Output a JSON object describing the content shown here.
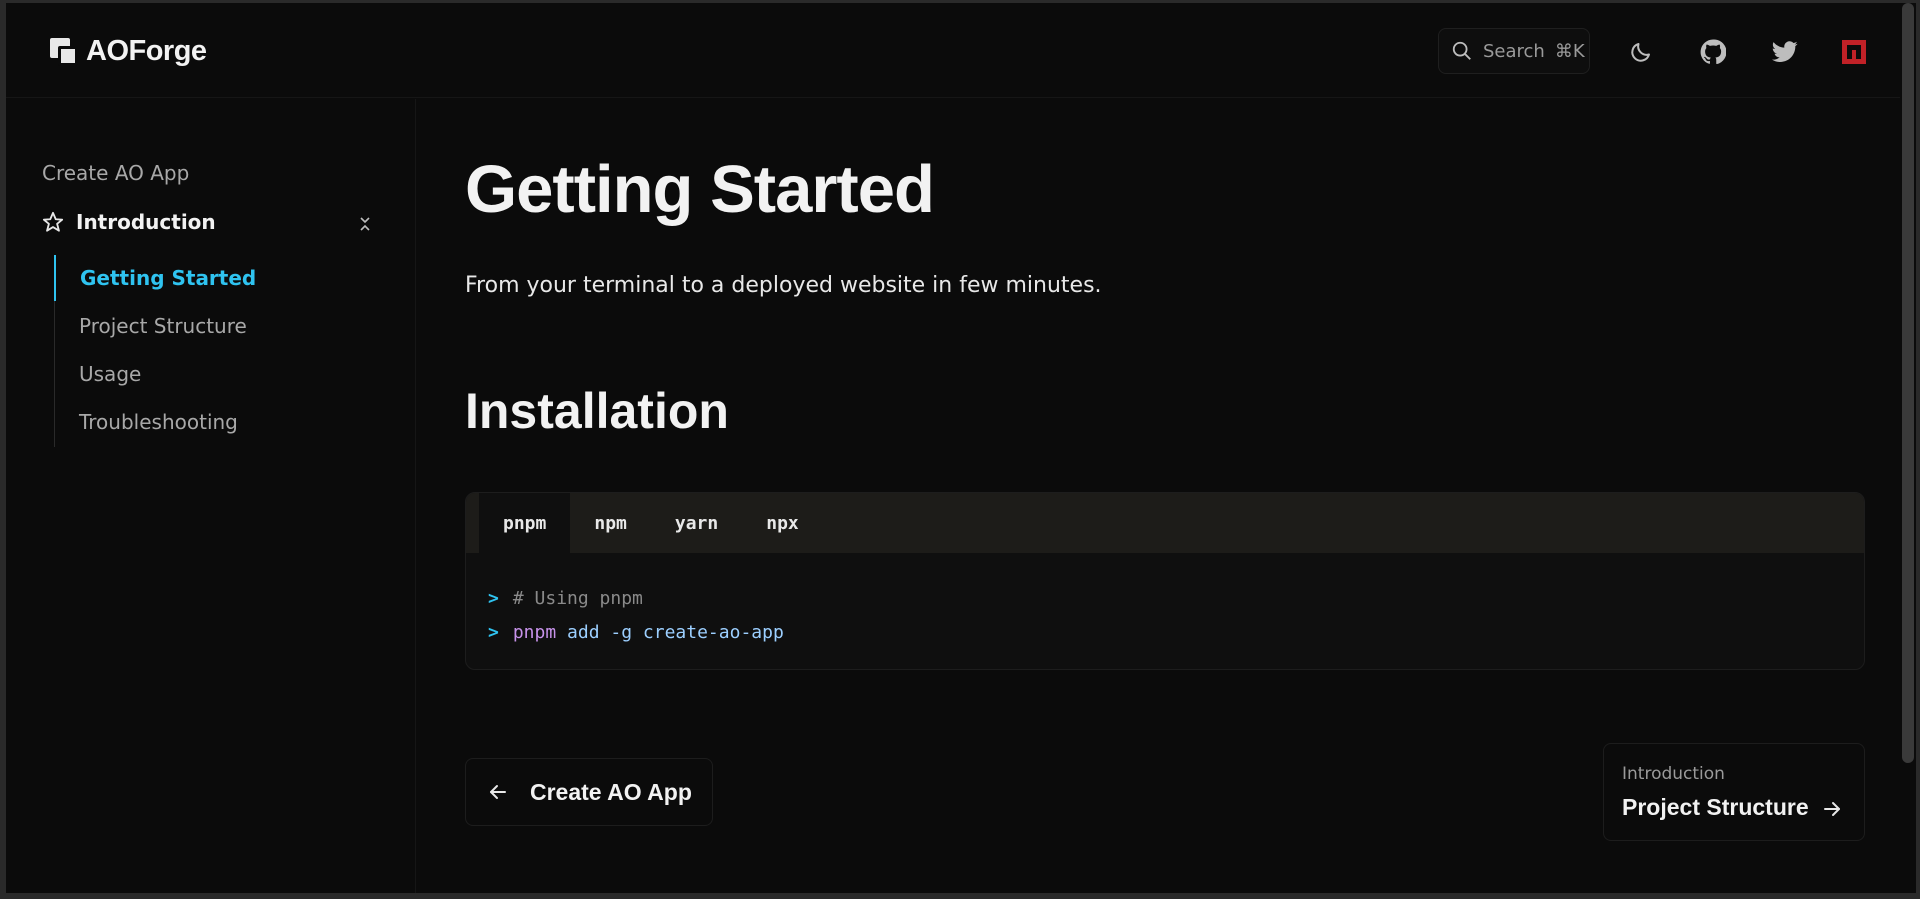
{
  "header": {
    "logo_text": "AOForge",
    "search": {
      "label": "Search",
      "shortcut": "⌘K"
    },
    "icons": [
      "moon-icon",
      "github-icon",
      "twitter-icon",
      "npm-icon"
    ]
  },
  "sidebar": {
    "top_link": "Create AO App",
    "section": {
      "label": "Introduction",
      "icon": "star-icon"
    },
    "items": [
      {
        "label": "Getting Started",
        "active": true
      },
      {
        "label": "Project Structure",
        "active": false
      },
      {
        "label": "Usage",
        "active": false
      },
      {
        "label": "Troubleshooting",
        "active": false
      }
    ]
  },
  "main": {
    "title": "Getting Started",
    "lead": "From your terminal to a deployed website in few minutes.",
    "installation_heading": "Installation",
    "code": {
      "tabs": [
        "pnpm",
        "npm",
        "yarn",
        "npx"
      ],
      "active_tab": "pnpm",
      "comment_line": "# Using pnpm",
      "command": {
        "tool": "pnpm",
        "args": "add -g create-ao-app"
      }
    },
    "nav": {
      "prev_label": "Create AO App",
      "next_small": "Introduction",
      "next_label": "Project Structure"
    }
  },
  "colors": {
    "accent": "#2fc3f0",
    "background": "#0b0b0b",
    "command": "#c792ea",
    "argument": "#9ccfff"
  }
}
